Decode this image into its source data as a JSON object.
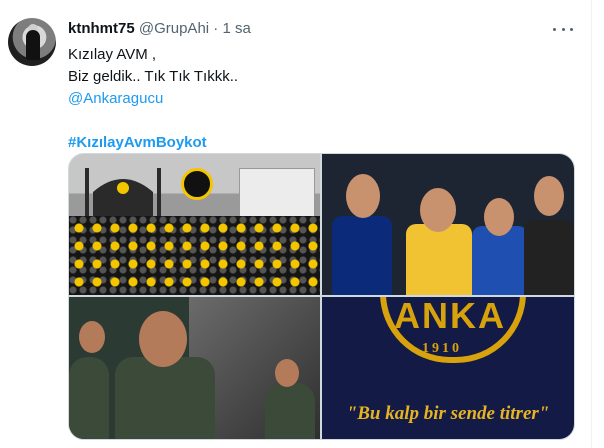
{
  "tweet": {
    "display_name": "ktnhmt75",
    "handle": "@GrupAhi",
    "separator": "·",
    "time": "1 sa",
    "lines": [
      "Kızılay AVM ,",
      "Biz geldik.. Tık Tık Tıkkk..",
      "@Ankaragucu",
      "",
      "#KızılayAvmBoykot"
    ],
    "mention": "@Ankaragucu",
    "hashtag": "#KızılayAvmBoykot"
  },
  "media": {
    "slogan": "\"Bu kalp bir sende titrer\"",
    "logo_year": "1910",
    "logo_letters": "ANKA"
  },
  "colors": {
    "link": "#1d9bf0",
    "secondary_text": "#536471",
    "logo_gold": "#d8a20d"
  },
  "icons": {
    "more": "more-horizontal-icon"
  }
}
